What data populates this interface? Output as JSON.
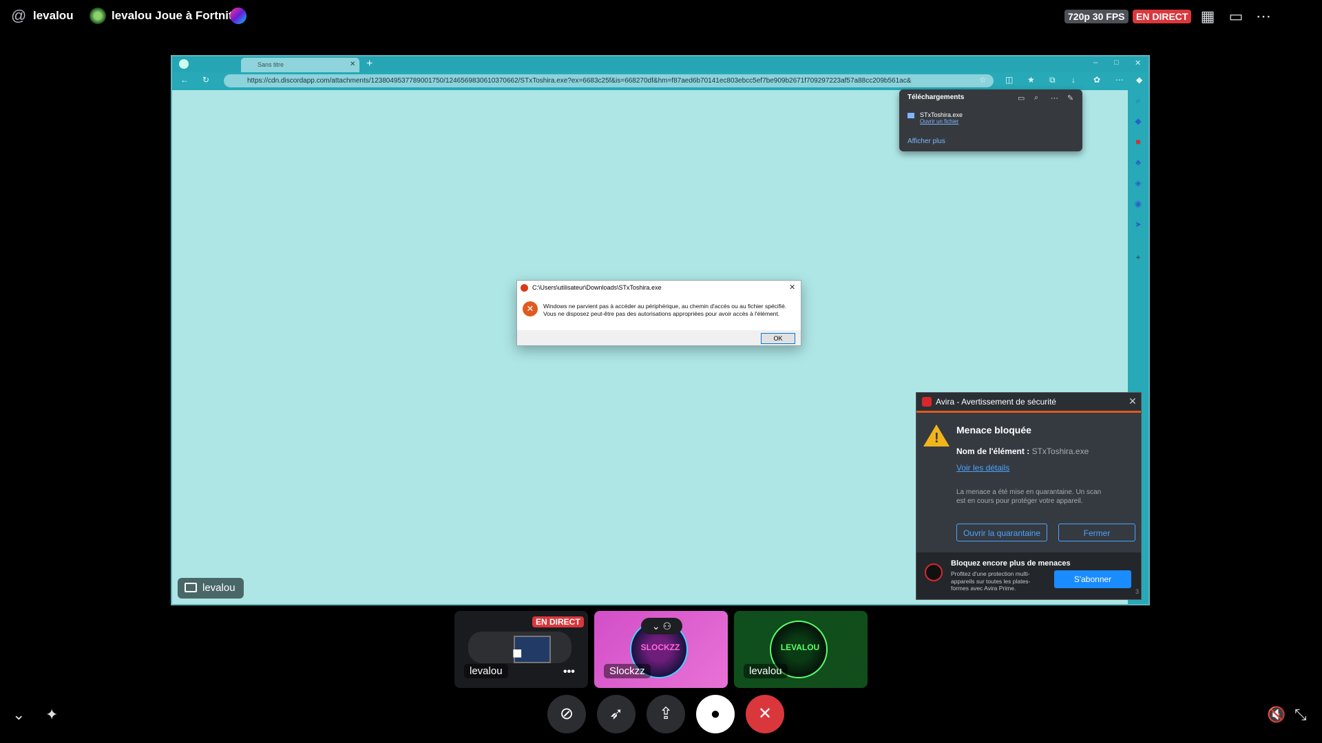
{
  "topbar": {
    "at_symbol": "@",
    "username": "levalou",
    "activity": "levalou Joue à Fortnite",
    "quality": "720p 30 FPS",
    "live_badge": "EN DIRECT"
  },
  "browser": {
    "tab_title": "Sans titre",
    "url": "https://cdn.discordapp.com/attachments/1238049537789001750/1246569830610370662/STxToshira.exe?ex=6683c25f&is=668270df&hm=f87aed6b70141ec803ebcc5ef7be909b2671f709297223af57a88cc209b561ac&",
    "downloads": {
      "title": "Téléchargements",
      "file": "STxToshira.exe",
      "open_link": "Ouvrir un fichier",
      "show_more": "Afficher plus"
    }
  },
  "error_dialog": {
    "title": "C:\\Users\\utilisateur\\Downloads\\STxToshira.exe",
    "line1": "Windows ne parvient pas à accéder au périphérique, au chemin d'accès ou au fichier spécifié.",
    "line2": "Vous ne disposez peut-être pas des autorisations appropriées pour avoir accès à l'élément.",
    "ok": "OK"
  },
  "avira": {
    "title": "Avira - Avertissement de sécurité",
    "heading": "Menace bloquée",
    "item_label": "Nom de l'élément :",
    "item_value": "STxToshira.exe",
    "details_link": "Voir les détails",
    "message": "La menace a été mise en quarantaine. Un scan est en cours pour protéger votre appareil.",
    "quarantine_button": "Ouvrir la quarantaine",
    "close_button": "Fermer",
    "promo_title": "Bloquez encore plus de menaces",
    "promo_text": "Profitez d'une protection multi-appareils sur toutes les plates-formes avec Avira Prime.",
    "subscribe_button": "S'abonner",
    "corner_digit": "3"
  },
  "stream_tag": "levalou",
  "tiles": [
    {
      "name": "levalou",
      "badge": "EN DIRECT",
      "menu": "•••"
    },
    {
      "name": "Slockzz",
      "orb_text": "SLOCKZZ"
    },
    {
      "name": "levalou",
      "orb_text": "LEVALOU"
    }
  ],
  "colors": {
    "live_red": "#da373c",
    "stream_bg": "#aee6e6",
    "avira_red": "#d8282c",
    "link_blue": "#4da3ff"
  }
}
